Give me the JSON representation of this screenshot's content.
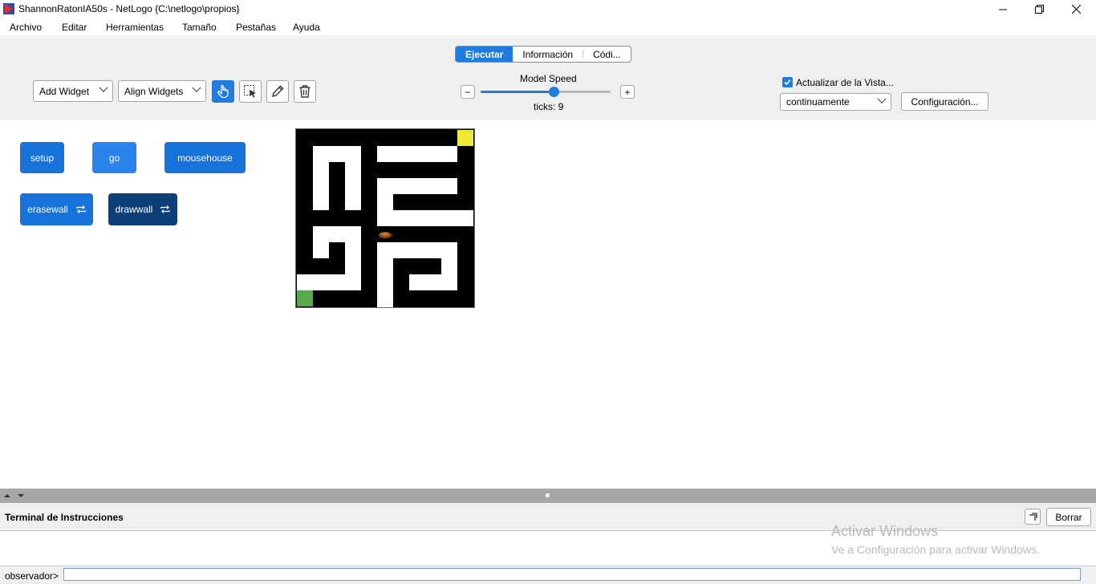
{
  "window": {
    "title": "ShannonRatonIA50s - NetLogo {C:\\netlogo\\propios}",
    "minimize_icon": "minimize-icon",
    "maximize_icon": "restore-icon",
    "close_icon": "close-icon"
  },
  "menu": [
    "Archivo",
    "Editar",
    "Herramientas",
    "Tamaño",
    "Pestañas",
    "Ayuda"
  ],
  "tabs": [
    "Ejecutar",
    "Información",
    "Códi..."
  ],
  "toolbar": {
    "add_widget": "Add Widget",
    "align_widgets": "Align Widgets",
    "tools": [
      "interact-hand-icon",
      "select-icon",
      "edit-pencil-icon",
      "delete-trash-icon"
    ],
    "speed_label": "Model Speed",
    "speed_minus": "−",
    "speed_plus": "+",
    "speed_value": 0.56,
    "ticks": "ticks: 9",
    "update_view_label": "Actualizar de la Vista...",
    "update_view_checked": true,
    "update_mode": "continuamente",
    "settings_button": "Configuración..."
  },
  "buttons": [
    {
      "label": "setup",
      "forever": false
    },
    {
      "label": "go",
      "forever": false
    },
    {
      "label": "mousehouse",
      "forever": false
    },
    {
      "label": "erasewall",
      "forever": true
    },
    {
      "label": "drawwall",
      "forever": true
    }
  ],
  "terminal": {
    "title": "Terminal de Instrucciones",
    "clear_button": "Borrar",
    "prompt": "observador>",
    "input_value": ""
  },
  "watermark": {
    "line1": "Activar Windows",
    "line2": "Ve a Configuración para activar Windows."
  },
  "colors": {
    "accent": "#1f7de0",
    "button": "#1872dc",
    "button_pressed": "#0d3f79",
    "goal": "#eeea33",
    "start": "#59a84b"
  }
}
